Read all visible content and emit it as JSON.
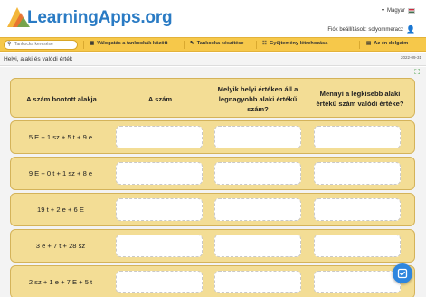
{
  "header": {
    "logo_text": "LearningApps.org",
    "language": "Magyar",
    "language_arrow": "▾",
    "account_label": "Fiók beállítások: solyommeracz"
  },
  "nav": {
    "search_placeholder": "Tankocka keresése",
    "items": [
      {
        "icon": "▦",
        "label": "Válogatás a tankockák között"
      },
      {
        "icon": "✎",
        "label": "Tankocka készítése"
      },
      {
        "icon": "☷",
        "label": "Gyűjtemény létrehozása"
      },
      {
        "icon": "▤",
        "label": "Az én dolgaim"
      }
    ]
  },
  "page": {
    "title": "Helyi, alaki és valódi érték",
    "date": "2022-09-31"
  },
  "table": {
    "headers": [
      "A szám bontott alakja",
      "A szám",
      "Melyik helyi értéken áll a legnagyobb alaki értékű szám?",
      "Mennyi a legkisebb alaki értékű szám valódi értéke?"
    ],
    "rows": [
      "5 E + 1 sz + 5 t + 9 e",
      "9 E + 0 t + 1 sz + 8 e",
      "19 t + 2 e + 6 E",
      "3 e + 7 t + 28 sz",
      "2 sz + 1 e + 7 E + 5 t"
    ]
  },
  "colors": {
    "nav_bg": "#f6c84a",
    "cell_bg": "#f3dd95",
    "logo": "#2a7bc4",
    "check_button": "#2e86de"
  }
}
